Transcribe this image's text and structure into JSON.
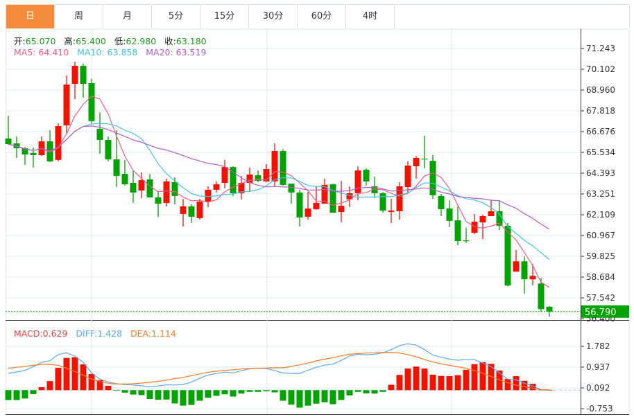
{
  "tabs": [
    {
      "label": "日",
      "active": true
    },
    {
      "label": "周"
    },
    {
      "label": "月"
    },
    {
      "label": "5分"
    },
    {
      "label": "15分"
    },
    {
      "label": "30分"
    },
    {
      "label": "60分"
    },
    {
      "label": "4时"
    }
  ],
  "ohlc_info": {
    "open_label": "开:",
    "open": "65.070",
    "high_label": "高:",
    "high": "65.400",
    "low_label": "低:",
    "low": "62.980",
    "close_label": "收:",
    "close": "63.180"
  },
  "ma_info": {
    "ma5": "MA5: 64.410",
    "ma10": "MA10: 63.858",
    "ma20": "MA20: 63.519"
  },
  "macd_info": {
    "macd": "MACD:0.629",
    "diff": "DIFF:1.428",
    "dea": "DEA:1.114"
  },
  "colors": {
    "up": "#f01400",
    "down": "#00a300",
    "ma5": "#f25a86",
    "ma10": "#3ec6e0",
    "ma20": "#b45ac8",
    "diff": "#5aaaf0",
    "dea": "#f57a22",
    "last_price_bg": "#00a300"
  },
  "chart_data": [
    {
      "type": "candlestick",
      "price_axis_ticks": [
        "71.243",
        "70.102",
        "68.960",
        "67.818",
        "66.676",
        "65.534",
        "64.393",
        "63.251",
        "62.109",
        "60.967",
        "59.825",
        "58.684",
        "57.542",
        "56.400"
      ],
      "ylim": [
        56.4,
        71.243
      ],
      "last_price": "56.790",
      "candles": [
        [
          66.3,
          67.55,
          65.95,
          65.99
        ],
        [
          66.03,
          66.41,
          65.23,
          65.76
        ],
        [
          65.76,
          65.84,
          64.85,
          65.42
        ],
        [
          65.5,
          65.8,
          64.7,
          65.38
        ],
        [
          65.38,
          66.41,
          65.34,
          66.14
        ],
        [
          66.14,
          66.75,
          65.0,
          65.04
        ],
        [
          65.12,
          67.13,
          65.04,
          66.98
        ],
        [
          67.02,
          69.76,
          66.56,
          69.26
        ],
        [
          69.3,
          70.52,
          68.46,
          70.29
        ],
        [
          70.29,
          70.41,
          68.54,
          69.3
        ],
        [
          69.34,
          69.57,
          67.09,
          67.25
        ],
        [
          66.83,
          67.74,
          65.46,
          66.22
        ],
        [
          66.22,
          66.41,
          65.04,
          65.15
        ],
        [
          65.15,
          66.75,
          63.63,
          64.24
        ],
        [
          64.35,
          65.12,
          63.71,
          63.78
        ],
        [
          63.86,
          64.54,
          62.76,
          63.33
        ],
        [
          63.44,
          64.43,
          63.02,
          64.01
        ],
        [
          64.05,
          64.35,
          63.06,
          63.06
        ],
        [
          63.06,
          63.36,
          61.98,
          62.72
        ],
        [
          62.75,
          64.09,
          62.57,
          63.94
        ],
        [
          63.9,
          64.16,
          62.68,
          63.14
        ],
        [
          62.15,
          62.98,
          61.46,
          62.57
        ],
        [
          62.57,
          62.68,
          61.65,
          62.0
        ],
        [
          61.92,
          62.98,
          61.84,
          62.83
        ],
        [
          62.83,
          63.67,
          62.53,
          63.48
        ],
        [
          63.48,
          63.94,
          63.33,
          63.78
        ],
        [
          63.86,
          65.12,
          63.56,
          64.73
        ],
        [
          64.73,
          64.77,
          63.14,
          63.29
        ],
        [
          63.29,
          64.24,
          62.95,
          63.86
        ],
        [
          63.86,
          64.7,
          63.36,
          64.32
        ],
        [
          64.28,
          64.54,
          63.9,
          63.97
        ],
        [
          63.94,
          64.89,
          63.9,
          64.62
        ],
        [
          63.94,
          66.03,
          63.67,
          65.61
        ],
        [
          65.61,
          65.72,
          63.71,
          63.75
        ],
        [
          63.82,
          63.82,
          62.72,
          63.33
        ],
        [
          63.33,
          63.48,
          61.46,
          61.96
        ],
        [
          62.0,
          63.36,
          61.84,
          62.45
        ],
        [
          62.41,
          63.67,
          62.38,
          62.76
        ],
        [
          62.72,
          64.09,
          62.72,
          63.75
        ],
        [
          63.78,
          63.82,
          62.22,
          62.22
        ],
        [
          62.26,
          63.97,
          61.69,
          62.6
        ],
        [
          62.95,
          63.67,
          62.53,
          63.29
        ],
        [
          63.29,
          64.77,
          62.91,
          64.54
        ],
        [
          64.58,
          64.66,
          63.71,
          63.94
        ],
        [
          63.67,
          64.2,
          63.02,
          63.29
        ],
        [
          63.29,
          63.36,
          62.22,
          62.34
        ],
        [
          62.26,
          62.98,
          61.65,
          62.34
        ],
        [
          62.3,
          63.9,
          61.84,
          63.67
        ],
        [
          63.63,
          65.04,
          63.29,
          64.81
        ],
        [
          64.77,
          65.34,
          64.09,
          65.23
        ],
        [
          65.19,
          66.45,
          64.66,
          65.15
        ],
        [
          65.07,
          65.4,
          62.98,
          63.18
        ],
        [
          63.14,
          63.25,
          62.03,
          62.41
        ],
        [
          62.45,
          62.91,
          61.42,
          61.77
        ],
        [
          61.8,
          62.57,
          60.43,
          60.66
        ],
        [
          60.7,
          61.39,
          60.55,
          60.68
        ],
        [
          61.12,
          62.15,
          61.04,
          61.73
        ],
        [
          61.69,
          62.11,
          60.77,
          62.03
        ],
        [
          62.03,
          62.91,
          62.03,
          62.3
        ],
        [
          62.3,
          62.91,
          61.27,
          61.5
        ],
        [
          61.5,
          61.65,
          58.18,
          58.22
        ],
        [
          58.98,
          60.17,
          58.98,
          59.55
        ],
        [
          59.55,
          59.82,
          57.78,
          58.56
        ],
        [
          58.56,
          59.4,
          58.22,
          58.75
        ],
        [
          58.33,
          58.64,
          56.77,
          56.92
        ],
        [
          57.05,
          57.09,
          56.5,
          56.79
        ]
      ],
      "ma_periods": [
        5,
        10,
        20
      ]
    },
    {
      "type": "bar+line",
      "macd_axis_ticks": [
        "1.782",
        "0.937",
        "0.092",
        "-0.753"
      ],
      "ylim": [
        -0.95,
        2.3
      ],
      "histogram": [
        -0.4,
        -0.4,
        -0.34,
        -0.16,
        0.12,
        0.37,
        0.91,
        1.31,
        1.34,
        1.05,
        0.66,
        0.41,
        0.18,
        -0.01,
        -0.1,
        -0.18,
        -0.2,
        -0.36,
        -0.39,
        -0.38,
        -0.54,
        -0.63,
        -0.6,
        -0.43,
        -0.31,
        -0.23,
        -0.17,
        -0.26,
        -0.14,
        -0.07,
        -0.07,
        -0.04,
        -0.09,
        -0.43,
        -0.59,
        -0.71,
        -0.63,
        -0.55,
        -0.49,
        -0.57,
        -0.4,
        -0.21,
        -0.07,
        -0.13,
        -0.14,
        -0.07,
        0.22,
        0.62,
        0.88,
        0.96,
        0.88,
        0.63,
        0.58,
        0.57,
        0.61,
        0.83,
        1.06,
        1.14,
        1.07,
        0.8,
        0.46,
        0.57,
        0.38,
        0.26,
        0.02,
        0.01
      ],
      "diff": [
        0.68,
        0.74,
        0.8,
        0.96,
        1.13,
        1.2,
        1.45,
        1.52,
        1.38,
        1.13,
        0.7,
        0.45,
        0.33,
        0.26,
        0.23,
        0.21,
        0.18,
        0.14,
        0.17,
        0.22,
        0.21,
        0.23,
        0.33,
        0.49,
        0.62,
        0.68,
        0.73,
        0.7,
        0.79,
        0.87,
        0.89,
        0.88,
        0.8,
        0.7,
        0.68,
        0.68,
        0.81,
        0.93,
        1.02,
        1.06,
        1.21,
        1.39,
        1.46,
        1.44,
        1.46,
        1.52,
        1.65,
        1.81,
        1.89,
        1.83,
        1.65,
        1.43,
        1.34,
        1.26,
        1.22,
        1.24,
        1.24,
        1.1,
        0.96,
        0.7,
        0.45,
        0.42,
        0.28,
        0.17,
        0.02,
        0.01
      ],
      "dea": [
        0.89,
        0.93,
        0.97,
        1.01,
        1.05,
        1.05,
        1.01,
        0.89,
        0.75,
        0.61,
        0.45,
        0.35,
        0.28,
        0.25,
        0.25,
        0.26,
        0.29,
        0.32,
        0.36,
        0.41,
        0.47,
        0.52,
        0.59,
        0.66,
        0.73,
        0.77,
        0.8,
        0.83,
        0.86,
        0.88,
        0.89,
        0.9,
        0.91,
        0.91,
        0.97,
        1.03,
        1.1,
        1.19,
        1.26,
        1.32,
        1.4,
        1.46,
        1.49,
        1.51,
        1.52,
        1.53,
        1.54,
        1.51,
        1.45,
        1.36,
        1.24,
        1.15,
        1.07,
        1.01,
        0.95,
        0.89,
        0.8,
        0.69,
        0.56,
        0.42,
        0.3,
        0.21,
        0.14,
        0.08,
        0.03,
        0.01
      ]
    }
  ]
}
